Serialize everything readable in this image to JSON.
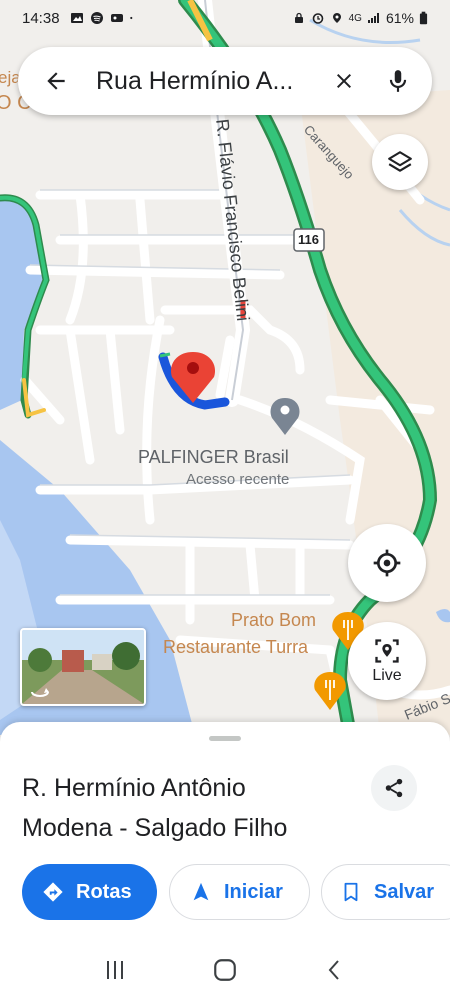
{
  "status_bar": {
    "time": "14:38",
    "battery": "61%",
    "network": "4G"
  },
  "search": {
    "query": "Rua Hermínio A...",
    "back_icon": "arrow-left-icon",
    "clear_icon": "close-icon",
    "voice_icon": "microphone-icon"
  },
  "map": {
    "street_labels": {
      "flavio": "R. Flávio Francisco Belini",
      "caranguejo": "Caranguejo",
      "fabio": "Fábio S"
    },
    "highway_shield": "116",
    "poi": {
      "palfinger_name": "PALFINGER Brasil",
      "palfinger_sub": "Acesso recente",
      "prato_bom": "Prato Bom",
      "turra": "Restaurante Turra"
    },
    "edge_labels": {
      "top_left_1": "eja",
      "top_left_2": "O C"
    },
    "colors": {
      "highway": "#34a853",
      "route": "#1a56db",
      "pin": "#ea4335",
      "water": "#a8c6f0",
      "restaurant": "#f29900"
    }
  },
  "controls": {
    "layers_icon": "layers-icon",
    "locate_icon": "my-location-icon",
    "live_label": "Live"
  },
  "sheet": {
    "title": "R. Hermínio Antônio Modena - Salgado Filho",
    "share_icon": "share-icon",
    "actions": {
      "rotas": "Rotas",
      "iniciar": "Iniciar",
      "salvar": "Salvar"
    }
  }
}
